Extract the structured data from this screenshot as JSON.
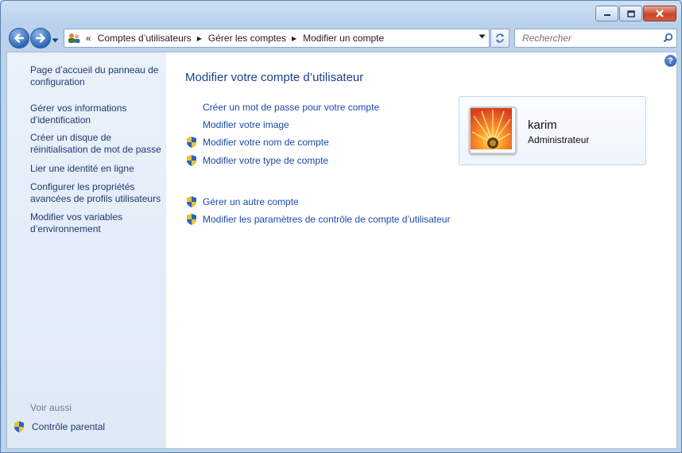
{
  "toolbar": {
    "address_crumbs": [
      "Comptes d’utilisateurs",
      "Gérer les comptes",
      "Modifier un compte"
    ],
    "address_prefix": "«",
    "search_placeholder": "Rechercher"
  },
  "nav": {
    "links": [
      "Page d’accueil du panneau de configuration",
      "Gérer vos informations d’identification",
      "Créer un disque de réinitialisation de mot de passe",
      "Lier une identité en ligne",
      "Configurer les propriétés avancées de profils utilisateurs",
      "Modifier vos variables d’environnement"
    ],
    "see_also": "Voir aussi",
    "parental": "Contrôle parental"
  },
  "main": {
    "title": "Modifier votre compte d’utilisateur",
    "tasks": [
      {
        "label": "Créer un mot de passe pour votre compte",
        "shield": false
      },
      {
        "label": "Modifier votre image",
        "shield": false
      },
      {
        "label": "Modifier votre nom de compte",
        "shield": true
      },
      {
        "label": "Modifier votre type de compte",
        "shield": true
      },
      {
        "label": "Gérer un autre compte",
        "shield": true
      },
      {
        "label": "Modifier les paramètres de contrôle de compte d’utilisateur",
        "shield": true
      }
    ],
    "help": "?"
  },
  "account": {
    "name": "karim",
    "role": "Administrateur"
  },
  "colors": {
    "link": "#1b4aa8",
    "nav_link": "#1e3a70",
    "title": "#1a3f8f"
  }
}
